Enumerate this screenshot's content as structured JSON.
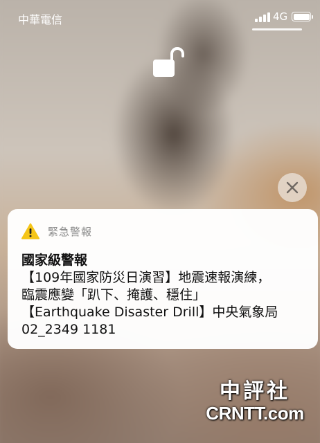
{
  "status_bar": {
    "carrier": "中華電信",
    "network": "4G",
    "signal_bars": 4,
    "battery_level": 1.0,
    "signal_icon": "cellular-signal-icon",
    "battery_icon": "battery-icon"
  },
  "lock": {
    "icon": "unlocked-padlock-icon"
  },
  "dismiss": {
    "icon": "close-icon"
  },
  "alert": {
    "icon": "warning-triangle-icon",
    "icon_color": "#f5c518",
    "app_name": "緊急警報",
    "title": "國家級警報",
    "lines": [
      "【109年國家防災日演習】地震速報演練，",
      "臨震應變「趴下、掩護、穩住」",
      "【Earthquake Disaster Drill】中央氣象局",
      "02_2349 1181"
    ]
  },
  "watermark": {
    "chinese": "中評社",
    "latin": "CRNTT.com"
  }
}
